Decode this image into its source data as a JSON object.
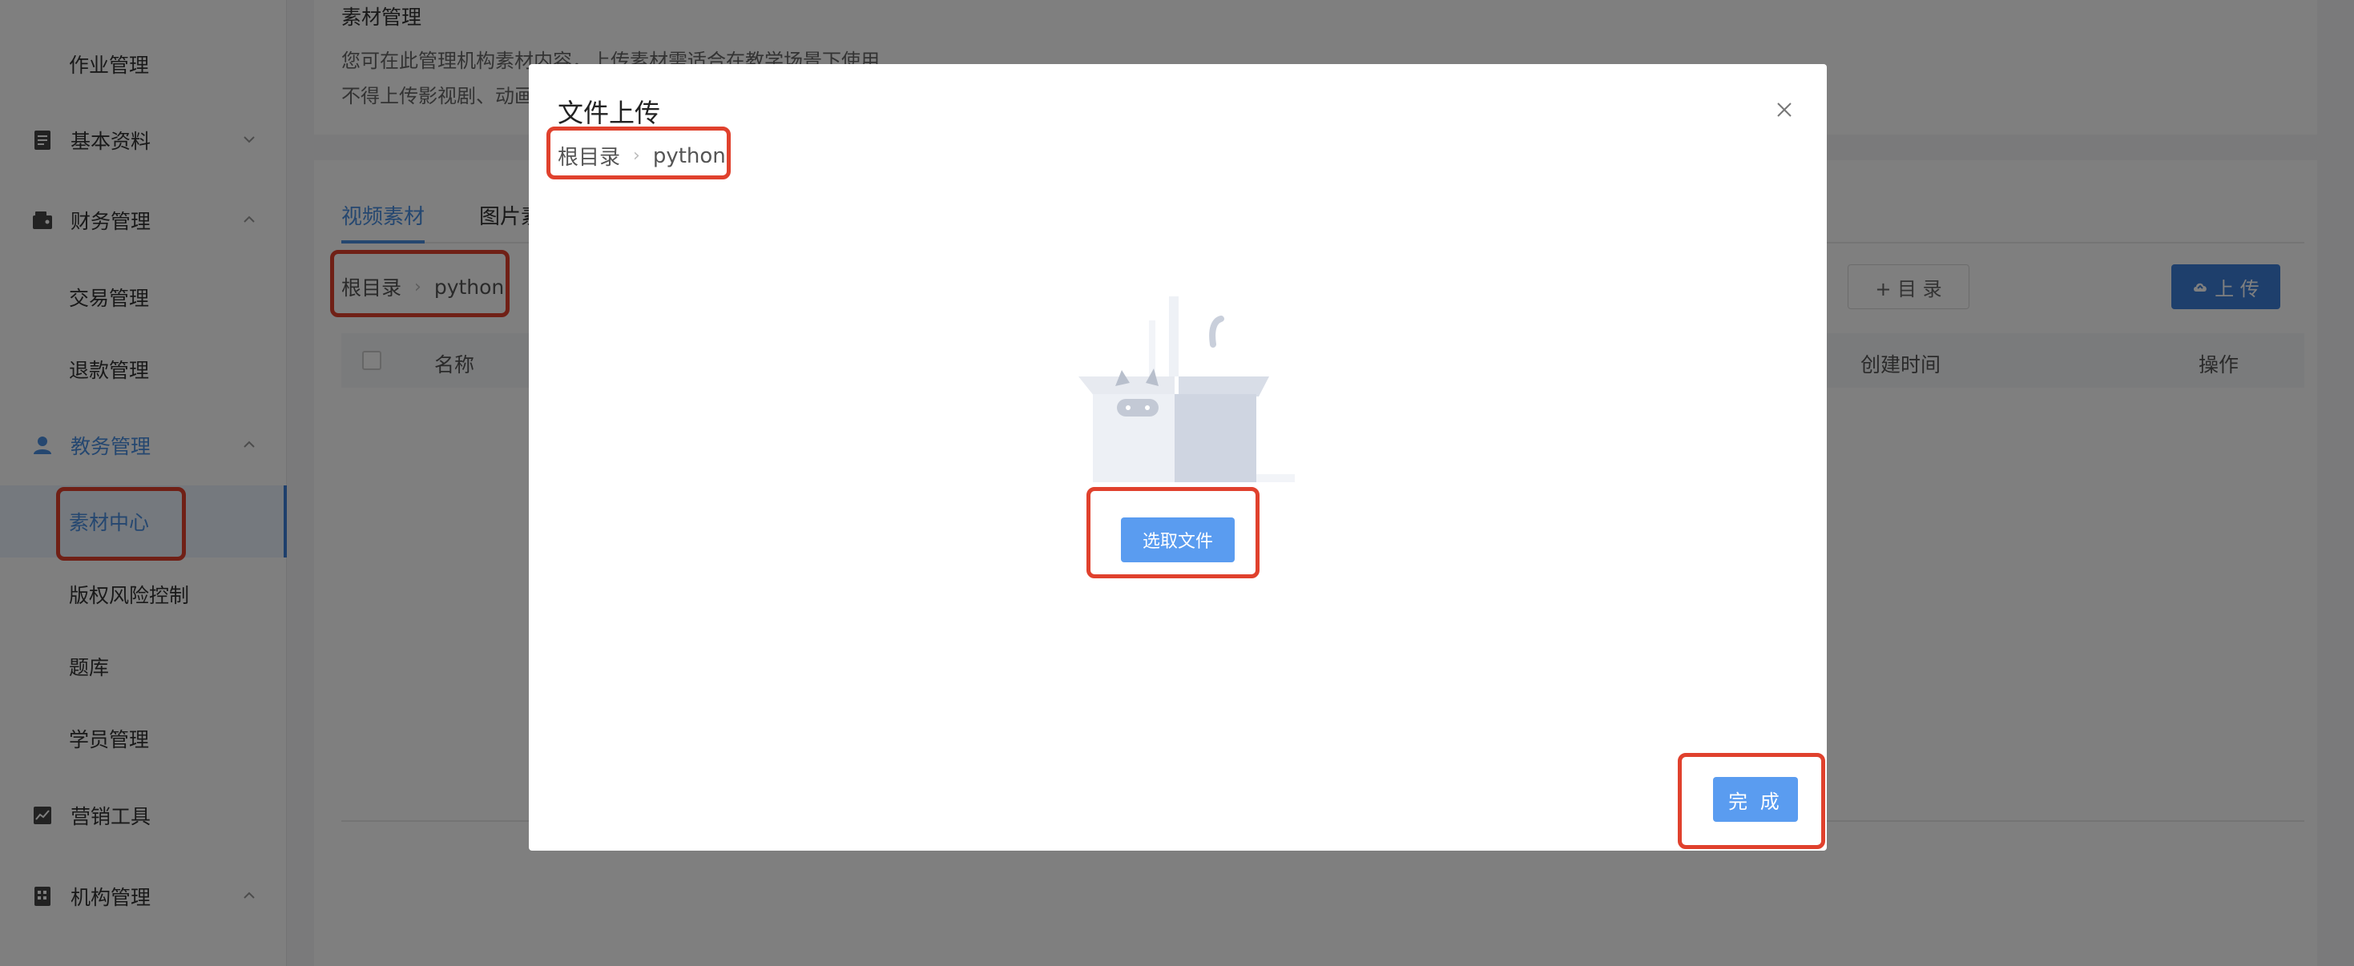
{
  "sidebar": {
    "items": [
      {
        "label": "作业管理",
        "type": "child"
      },
      {
        "label": "基本资料",
        "type": "parent",
        "icon": "document-icon",
        "chevron": "down"
      },
      {
        "label": "财务管理",
        "type": "parent",
        "icon": "wallet-icon",
        "chevron": "up"
      },
      {
        "label": "交易管理",
        "type": "child"
      },
      {
        "label": "退款管理",
        "type": "child"
      },
      {
        "label": "教务管理",
        "type": "parent",
        "icon": "user-icon",
        "chevron": "up"
      },
      {
        "label": "素材中心",
        "type": "child"
      },
      {
        "label": "版权风险控制",
        "type": "child"
      },
      {
        "label": "题库",
        "type": "child"
      },
      {
        "label": "学员管理",
        "type": "child"
      },
      {
        "label": "营销工具",
        "type": "parent",
        "icon": "chart-line-icon"
      },
      {
        "label": "机构管理",
        "type": "parent",
        "icon": "building-icon",
        "chevron": "up"
      }
    ]
  },
  "header": {
    "title": "素材管理",
    "desc_line1": "您可在此管理机构素材内容，上传素材需适合在教学场景下使用",
    "desc_line2": "不得上传影视剧、动画"
  },
  "content": {
    "tabs": [
      "视频素材",
      "图片素"
    ],
    "breadcrumb": {
      "root": "根目录",
      "current": "python"
    },
    "new_dir_button": "+ 目 录",
    "upload_button": "上 传",
    "columns": {
      "name": "名称",
      "created": "创建时间",
      "actions": "操作"
    }
  },
  "modal": {
    "title": "文件上传",
    "breadcrumb": {
      "root": "根目录",
      "current": "python"
    },
    "select_button": "选取文件",
    "done_button": "完 成"
  },
  "colors": {
    "accent": "#4a8fe0",
    "button": "#5a9cf0",
    "highlight": "#e0412d"
  }
}
